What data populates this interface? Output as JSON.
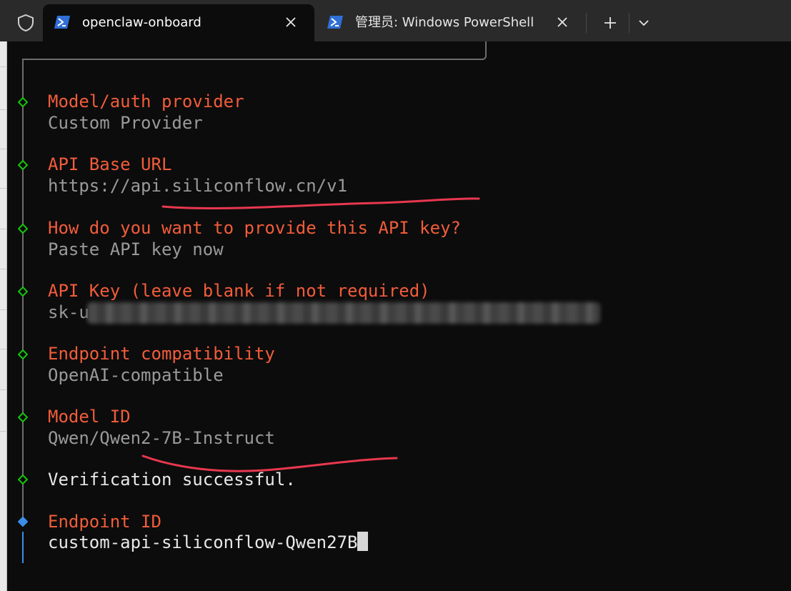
{
  "tabs": [
    {
      "title": "openclaw-onboard",
      "active": true,
      "icon": "powershell-icon"
    },
    {
      "title": "管理员: Windows PowerShell",
      "active": false,
      "icon": "powershell-icon"
    }
  ],
  "tab_actions": {
    "new_tab": "plus-icon",
    "dropdown": "chevron-down-icon"
  },
  "terminal": {
    "steps": [
      {
        "label": "Model/auth provider",
        "value": "Custom Provider"
      },
      {
        "label": "API Base URL",
        "value": "https://api.siliconflow.cn/v1"
      },
      {
        "label": "How do you want to provide this API key?",
        "value": "Paste API key now"
      },
      {
        "label": "API Key (leave blank if not required)",
        "value": "sk-u"
      },
      {
        "label": "Endpoint compatibility",
        "value": "OpenAI-compatible"
      },
      {
        "label": "Model ID",
        "value": "Qwen/Qwen2-7B-Instruct"
      }
    ],
    "status": "Verification successful.",
    "active_prompt": {
      "label": "Endpoint ID",
      "input_value": "custom-api-siliconflow-Qwen27B"
    }
  },
  "colors": {
    "label": "#f25c3b",
    "value": "#9a9a9a",
    "done_marker": "#16c60c",
    "active_marker": "#3b8eea",
    "annotation": "#e8384f"
  }
}
